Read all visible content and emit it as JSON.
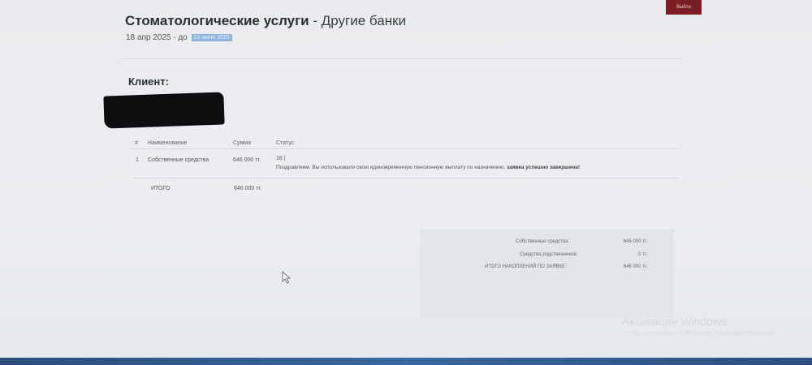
{
  "header": {
    "title": "Стоматологические услуги",
    "separator": " - ",
    "subtitle": "Другие банки",
    "date_prefix": "18 апр 2025 - до",
    "date_badge": "23 июня 2025",
    "top_button": "Выйти"
  },
  "client": {
    "label": "Клиент:"
  },
  "table": {
    "headers": [
      "#",
      "Наименование",
      "Сумма",
      "Статус"
    ],
    "rows": [
      {
        "num": "1",
        "name": "Собственные средства",
        "amount": "646 000 тг.",
        "status_code": "16 |",
        "status_text": "Поздравляем. Вы использовали свою единовременную пенсионную выплату по назначению, ",
        "status_strong": "заявка успешно завершена!"
      }
    ],
    "total_label": "ИТОГО",
    "total_amount": "646 000 тг."
  },
  "summary": {
    "own_label": "Собственные средства:",
    "own_value": "646 000 тг.",
    "relatives_label": "Средства родственников:",
    "relatives_value": "0 тг.",
    "total_label": "ИТОГО НАКОПЛЕНИЙ ПО ЗАЯВКЕ:",
    "total_value": "646 000 тг."
  },
  "watermark": {
    "line1": "Активация Windows",
    "line2": "Чтобы активировать Windows, перейдите в раздел"
  },
  "colors": {
    "accent_button": "#7a1e24",
    "date_badge": "#8fb4dc",
    "taskbar": "#3a67a0"
  }
}
